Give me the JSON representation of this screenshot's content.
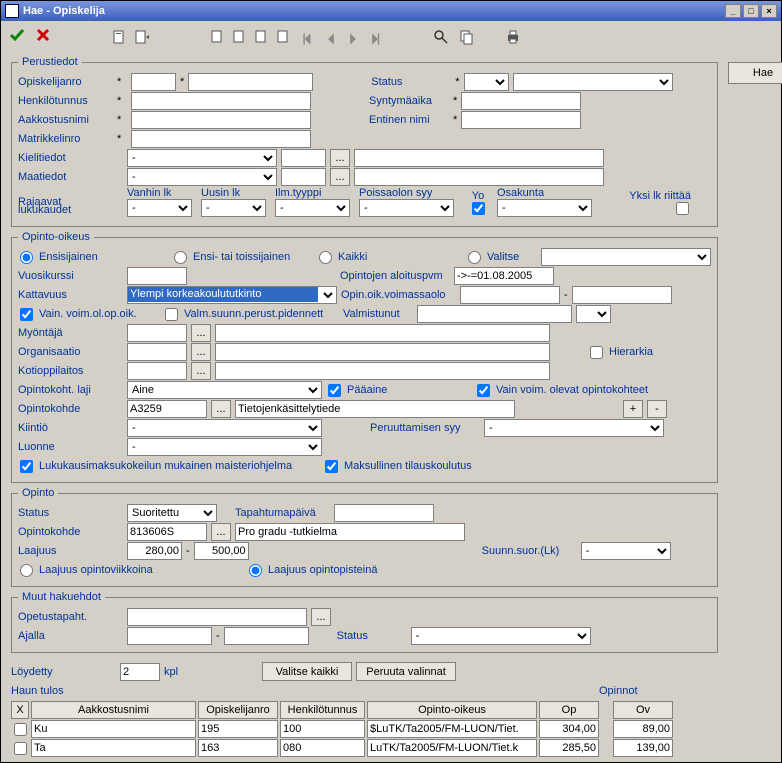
{
  "title": "Hae - Opiskelija",
  "hae_button": "Hae",
  "perustiedot": {
    "legend": "Perustiedot",
    "opiskelijanro": "Opiskelijanro",
    "henkilotunnus": "Henkilötunnus",
    "aakkostusnimi": "Aakkostusnimi",
    "matrikkelinro": "Matrikkelinro",
    "kielitiedot": "Kielitiedot",
    "maatiedot": "Maatiedot",
    "status": "Status",
    "syntymaaika": "Syntymäaika",
    "entinen_nimi": "Entinen nimi",
    "rajaavat": "Rajaavat",
    "lukukaudet": "lukukaudet",
    "vanhin_lk": "Vanhin lk",
    "uusin_lk": "Uusin lk",
    "ilm_tyyppi": "Ilm.tyyppi",
    "poissaolon_syy": "Poissaolon syy",
    "yo": "Yo",
    "osakunta": "Osakunta",
    "yksi_lk": "Yksi lk riittää",
    "asterisk": "*",
    "dash": "-"
  },
  "opinto_oikeus": {
    "legend": "Opinto-oikeus",
    "ensisijainen": "Ensisijainen",
    "ensi_tai": "Ensi- tai toissijainen",
    "kaikki": "Kaikki",
    "valitse": "Valitse",
    "vuosikurssi": "Vuosikurssi",
    "opintojen_aloitus": "Opintojen aloituspvm",
    "aloitus_val": "->-=01.08.2005",
    "kattavuus": "Kattavuus",
    "kattavuus_val": "Ylempi korkeakoulututkinto",
    "opin_oik_voim": "Opin.oik.voimassaolo",
    "vain_voim": "Vain. voim.ol.op.oik.",
    "valm_suunn": "Valm.suunn.perust.pidennett",
    "valmistunut": "Valmistunut",
    "myontaja": "Myöntäjä",
    "organisaatio": "Organisaatio",
    "hierarkia": "Hierarkia",
    "kotioppilaitos": "Kotioppilaitos",
    "opintokoht_laji": "Opintokoht. laji",
    "aine": "Aine",
    "paaaine": "Pääaine",
    "vain_voim_olevat": "Vain voim. olevat opintokohteet",
    "opintokohde": "Opintokohde",
    "opintokohde_val": "A3259",
    "opintokohde_name": "Tietojenkäsittelytiede",
    "kiintio": "Kiintiö",
    "peruuttamisen_syy": "Peruuttamisen syy",
    "luonne": "Luonne",
    "lukukausimaksu": "Lukukausimaksukokeilun mukainen maisteriohjelma",
    "maksullinen": "Maksullinen tilauskoulutus",
    "plus": "+",
    "minus": "-",
    "dash": "-"
  },
  "opinto": {
    "legend": "Opinto",
    "status": "Status",
    "status_val": "Suoritettu",
    "tapahtumapaiva": "Tapahtumapäivä",
    "opintokohde": "Opintokohde",
    "opintokohde_val": "813606S",
    "opintokohde_name": "Pro gradu -tutkielma",
    "laajuus": "Laajuus",
    "laajuus_min": "280,00",
    "laajuus_max": "500,00",
    "suunn_suor": "Suunn.suor.(Lk)",
    "laajuus_ov": "Laajuus opintoviikkoina",
    "laajuus_op": "Laajuus opintopisteinä",
    "dash": "-"
  },
  "muut": {
    "legend": "Muut hakuehdot",
    "opetustapaht": "Opetustapaht.",
    "ajalla": "Ajalla",
    "status": "Status",
    "dash": "-"
  },
  "results": {
    "loydetty": "Löydetty",
    "loydetty_val": "2",
    "kpl": "kpl",
    "valitse_kaikki": "Valitse kaikki",
    "peruuta": "Peruuta valinnat",
    "haun_tulos": "Haun tulos",
    "opinnot": "Opinnot",
    "x": "X",
    "aakkostusnimi": "Aakkostusnimi",
    "opiskelijanro": "Opiskelijanro",
    "henkilotunnus": "Henkilötunnus",
    "opinto_oikeus": "Opinto-oikeus",
    "op": "Op",
    "ov": "Ov",
    "rows": [
      {
        "aakko": "Ku",
        "onro": "195",
        "htun": "100",
        "oik": "$LuTK/Ta2005/FM-LUON/Tiet.",
        "op": "304,00",
        "ov": "89,00"
      },
      {
        "aakko": "Ta",
        "onro": "163",
        "htun": "080",
        "oik": "LuTK/Ta2005/FM-LUON/Tiet.k",
        "op": "285,50",
        "ov": "139,00"
      }
    ]
  },
  "ellipsis": "..."
}
